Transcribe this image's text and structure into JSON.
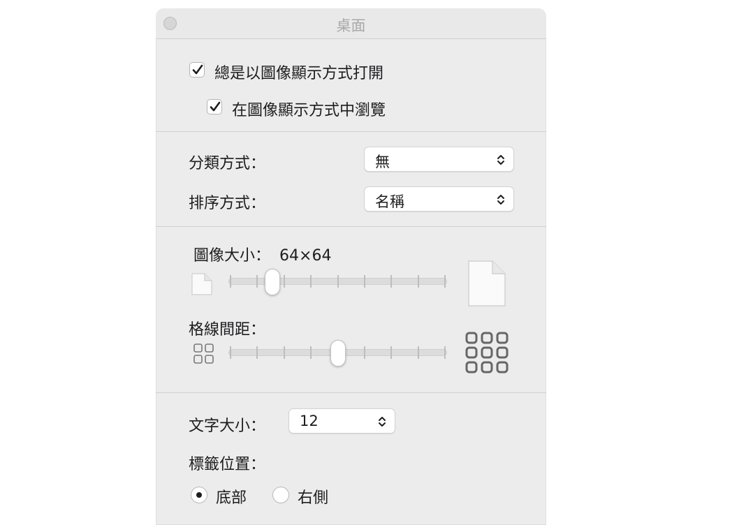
{
  "window": {
    "title": "桌面"
  },
  "view_options": {
    "always_open_icon_view": {
      "label": "總是以圖像顯示方式打開",
      "checked": true
    },
    "browse_in_icon_view": {
      "label": "在圖像顯示方式中瀏覽",
      "checked": true
    }
  },
  "grouping": {
    "group_by": {
      "label": "分類方式：",
      "value": "無"
    },
    "sort_by": {
      "label": "排序方式：",
      "value": "名稱"
    }
  },
  "icon_size": {
    "label": "圖像大小：",
    "value": "64×64",
    "slider_fraction": 0.2
  },
  "grid_spacing": {
    "label": "格線間距：",
    "slider_fraction": 0.5
  },
  "text": {
    "size": {
      "label": "文字大小：",
      "value": "12"
    },
    "label_position": {
      "label": "標籤位置：",
      "options": [
        {
          "label": "底部",
          "selected": true
        },
        {
          "label": "右側",
          "selected": false
        }
      ]
    }
  },
  "icons": {
    "close": "close-button-icon",
    "small_doc": "small-document-icon",
    "large_doc": "large-document-icon",
    "small_grid": "small-grid-icon",
    "large_grid": "large-grid-icon",
    "checkmark": "checkmark-icon",
    "chevron": "chevron-up-down-icon"
  }
}
